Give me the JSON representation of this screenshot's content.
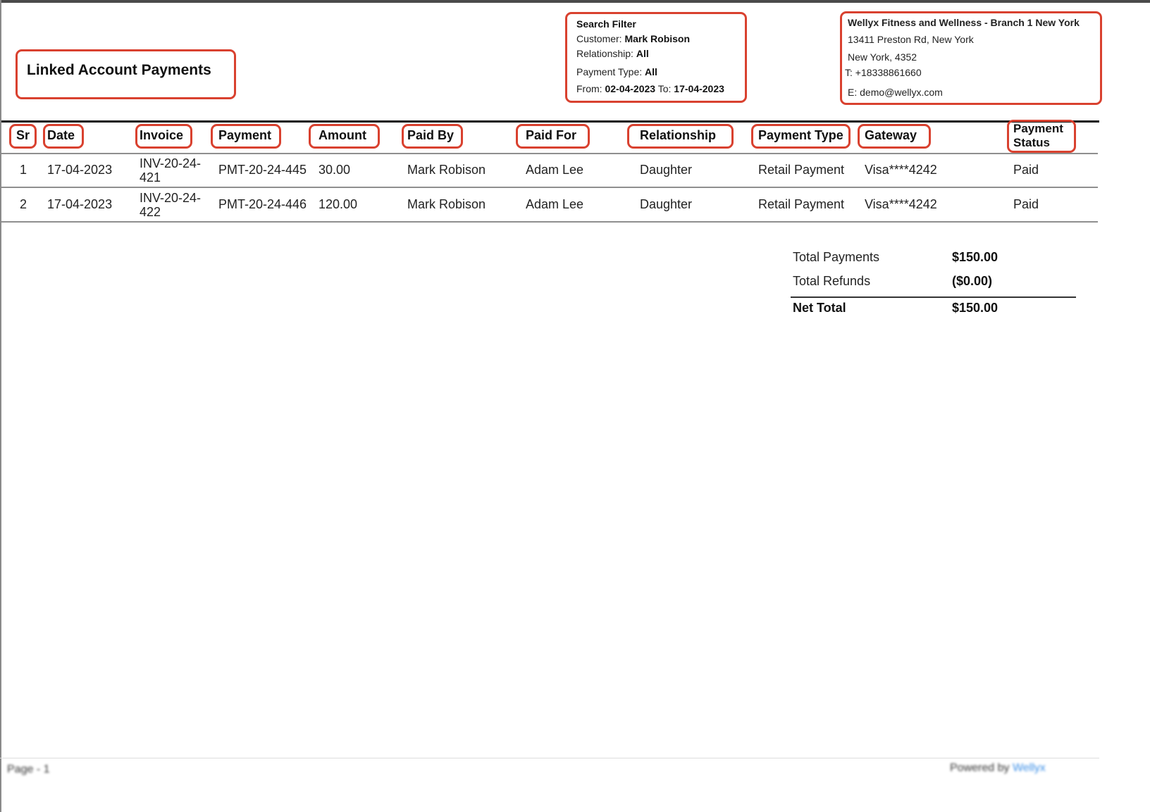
{
  "report": {
    "title": "Linked Account Payments"
  },
  "search_filter": {
    "heading": "Search Filter",
    "customer_label": "Customer:",
    "customer_value": "Mark Robison",
    "relationship_label": "Relationship:",
    "relationship_value": "All",
    "payment_type_label": "Payment Type:",
    "payment_type_value": "All",
    "from_label": "From:",
    "from_value": "02-04-2023",
    "to_label": "To:",
    "to_value": "17-04-2023"
  },
  "branch": {
    "name": "Wellyx Fitness and Wellness - Branch 1 New York",
    "address_line1": "13411 Preston Rd, New York",
    "address_line2": "New York, 4352",
    "phone": "T: +18338861660",
    "email": "E: demo@wellyx.com"
  },
  "table": {
    "columns": {
      "sr": "Sr",
      "date": "Date",
      "invoice": "Invoice",
      "payment": "Payment",
      "amount": "Amount",
      "paid_by": "Paid By",
      "paid_for": "Paid For",
      "relationship": "Relationship",
      "payment_type": "Payment Type",
      "gateway": "Gateway",
      "payment_status": "Payment Status"
    },
    "rows": [
      {
        "sr": "1",
        "date": "17-04-2023",
        "invoice": "INV-20-24-421",
        "payment": "PMT-20-24-445",
        "amount": "30.00",
        "paid_by": "Mark Robison",
        "paid_for": "Adam Lee",
        "relationship": "Daughter",
        "payment_type": "Retail Payment",
        "gateway": "Visa****4242",
        "payment_status": "Paid"
      },
      {
        "sr": "2",
        "date": "17-04-2023",
        "invoice": "INV-20-24-422",
        "payment": "PMT-20-24-446",
        "amount": "120.00",
        "paid_by": "Mark Robison",
        "paid_for": "Adam Lee",
        "relationship": "Daughter",
        "payment_type": "Retail Payment",
        "gateway": "Visa****4242",
        "payment_status": "Paid"
      }
    ]
  },
  "summary": {
    "total_payments_label": "Total Payments",
    "total_payments_value": "$150.00",
    "total_refunds_label": "Total Refunds",
    "total_refunds_value": "($0.00)",
    "net_total_label": "Net Total",
    "net_total_value": "$150.00"
  },
  "footer": {
    "page_text": "Page - 1",
    "powered_text": "Powered by",
    "brand": "Wellyx"
  },
  "colors": {
    "highlight_border": "#d9412f",
    "footer_brand": "#3a8ee6"
  }
}
